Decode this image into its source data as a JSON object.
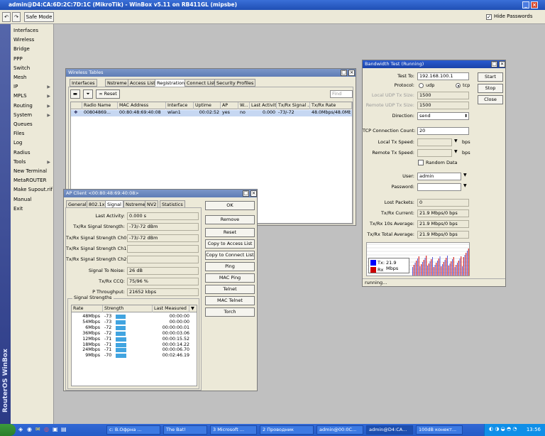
{
  "window": {
    "title": "admin@D4:CA:6D:2C:7D:1C (MikroTik) - WinBox v5.11 on RB411GL (mipsbe)"
  },
  "toolbar": {
    "safe_mode": "Safe Mode",
    "hide_passwords": "Hide Passwords",
    "hide_passwords_checked": true
  },
  "sidebar": {
    "brand": "RouterOS WinBox",
    "items": [
      {
        "label": "Interfaces",
        "submenu": false
      },
      {
        "label": "Wireless",
        "submenu": false
      },
      {
        "label": "Bridge",
        "submenu": false
      },
      {
        "label": "PPP",
        "submenu": false
      },
      {
        "label": "Switch",
        "submenu": false
      },
      {
        "label": "Mesh",
        "submenu": false
      },
      {
        "label": "IP",
        "submenu": true
      },
      {
        "label": "MPLS",
        "submenu": true
      },
      {
        "label": "Routing",
        "submenu": true
      },
      {
        "label": "System",
        "submenu": true
      },
      {
        "label": "Queues",
        "submenu": false
      },
      {
        "label": "Files",
        "submenu": false
      },
      {
        "label": "Log",
        "submenu": false
      },
      {
        "label": "Radius",
        "submenu": false
      },
      {
        "label": "Tools",
        "submenu": true
      },
      {
        "label": "New Terminal",
        "submenu": false
      },
      {
        "label": "MetaROUTER",
        "submenu": false
      },
      {
        "label": "Make Supout.rif",
        "submenu": false
      },
      {
        "label": "Manual",
        "submenu": false
      },
      {
        "label": "Exit",
        "submenu": false
      }
    ]
  },
  "wireless": {
    "title": "Wireless Tables",
    "tabs": [
      "Interfaces",
      "Nstreme Dual",
      "Access List",
      "Registration",
      "Connect List",
      "Security Profiles"
    ],
    "reset": "Reset",
    "find_placeholder": "Find",
    "columns": [
      "",
      "Radio Name",
      "MAC Address",
      "Interface",
      "Uptime",
      "AP",
      "W...",
      "Last Activit...",
      "Tx/Rx Signal ...",
      "Tx/Rx Rate"
    ],
    "row": {
      "radio_name": "00804869...",
      "mac": "00:80:48:69:40:08",
      "interface": "wlan1",
      "uptime": "00:02:52",
      "ap": "yes",
      "w": "no",
      "last_activity": "0.000",
      "signal": "-73/-72",
      "rate": "48.0Mbps/48.0Mbps"
    }
  },
  "apclient": {
    "title": "AP Client <00:80:48:69:40:08>",
    "tabs": [
      "General",
      "802.1x",
      "Signal",
      "Nstreme",
      "NV2",
      "Statistics"
    ],
    "fields": [
      {
        "label": "Last Activity:",
        "value": "0.000 s"
      },
      {
        "label": "Tx/Rx Signal Strength:",
        "value": "-73/-72 dBm"
      },
      {
        "label": "Tx/Rx Signal Strength Ch0:",
        "value": "-73/-72 dBm"
      },
      {
        "label": "Tx/Rx Signal Strength Ch1:",
        "value": ""
      },
      {
        "label": "Tx/Rx Signal Strength Ch2:",
        "value": ""
      },
      {
        "label": "Signal To Noise:",
        "value": "26 dB"
      },
      {
        "label": "Tx/Rx CCQ:",
        "value": "75/96 %"
      },
      {
        "label": "P Throughput:",
        "value": "21652 kbps"
      }
    ],
    "buttons": [
      "OK",
      "Remove",
      "Reset",
      "Copy to Access List",
      "Copy to Connect List",
      "Ping",
      "MAC Ping",
      "Telnet",
      "MAC Telnet",
      "Torch"
    ],
    "strengths_title": "Signal Strengths",
    "strength_columns": [
      "Rate",
      "Strength",
      "Last Measured"
    ],
    "strengths": [
      {
        "rate": "48Mbps",
        "strength": "-73",
        "last": "00:00:00"
      },
      {
        "rate": "54Mbps",
        "strength": "-73",
        "last": "00:00:00"
      },
      {
        "rate": "6Mbps",
        "strength": "-72",
        "last": "00:00:00.01"
      },
      {
        "rate": "36Mbps",
        "strength": "-72",
        "last": "00:00:03.06"
      },
      {
        "rate": "12Mbps",
        "strength": "-71",
        "last": "00:00:15.52"
      },
      {
        "rate": "18Mbps",
        "strength": "-71",
        "last": "00:00:14.22"
      },
      {
        "rate": "24Mbps",
        "strength": "-71",
        "last": "00:00:06.70"
      },
      {
        "rate": "9Mbps",
        "strength": "-70",
        "last": "00:02:46.19"
      }
    ]
  },
  "btest": {
    "title": "Bandwidth Test (Running)",
    "buttons": [
      "Start",
      "Stop",
      "Close"
    ],
    "test_to_label": "Test To:",
    "test_to": "192.168.100.1",
    "protocol_label": "Protocol:",
    "udp": "udp",
    "tcp": "tcp",
    "local_udp_label": "Local UDP Tx Size:",
    "local_udp": "1500",
    "remote_udp_label": "Remote UDP Tx Size:",
    "remote_udp": "1500",
    "direction_label": "Direction:",
    "direction": "send",
    "tcp_conn_label": "TCP Connection Count:",
    "tcp_conn": "20",
    "local_speed_label": "Local Tx Speed:",
    "remote_speed_label": "Remote Tx Speed:",
    "bps": "bps",
    "random_label": "Random Data",
    "user_label": "User:",
    "user": "admin",
    "password_label": "Password:",
    "lost_label": "Lost Packets:",
    "lost": "0",
    "txcur_label": "Tx/Rx Current:",
    "txcur": "21.9 Mbps/0 bps",
    "tx10_label": "Tx/Rx 10s Average:",
    "tx10": "21.9 Mbps/0 bps",
    "txtot_label": "Tx/Rx Total Average:",
    "txtot": "21.9 Mbps/0 bps",
    "legend_tx": "Tx:",
    "legend_tx_value": "21.9 Mbps",
    "legend_rx": "Rx",
    "status": "running..."
  },
  "taskbar": {
    "tasks": [
      "с: В.Офрна ...",
      "The Bat!",
      "3 Microsoft ...",
      "2 Проводник",
      "admin@00:0C...",
      "admin@D4:CA...",
      "100dB конект..."
    ],
    "clock": "13:56"
  },
  "colors": {
    "tx": "#0000ff",
    "rx": "#cc0000",
    "signal": "#41a4e0"
  }
}
